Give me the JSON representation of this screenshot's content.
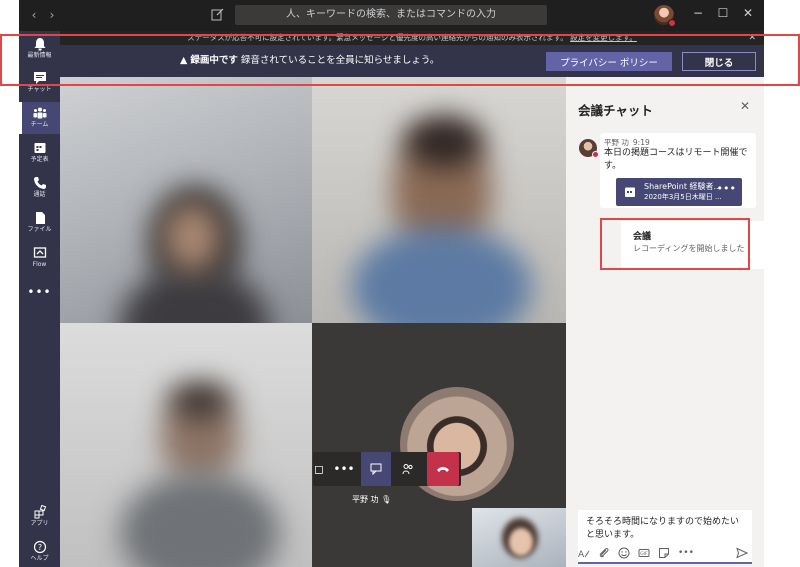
{
  "titlebar": {
    "back_icon": "chevron-left-icon",
    "forward_icon": "chevron-right-icon",
    "search_placeholder": "人、キーワードの検索、またはコマンドの入力",
    "minimize": "−",
    "maximize": "☐",
    "close": "✕"
  },
  "rail": {
    "items": [
      {
        "label": "最新情報",
        "icon": "bell-icon"
      },
      {
        "label": "チャット",
        "icon": "chat-icon"
      },
      {
        "label": "チーム",
        "icon": "teams-icon"
      },
      {
        "label": "予定表",
        "icon": "calendar-icon"
      },
      {
        "label": "通話",
        "icon": "phone-icon"
      },
      {
        "label": "ファイル",
        "icon": "file-icon"
      },
      {
        "label": "Flow",
        "icon": "flow-icon"
      }
    ],
    "more": "•••",
    "bottom": [
      {
        "label": "アプリ",
        "icon": "apps-icon"
      },
      {
        "label": "ヘルプ",
        "icon": "help-icon"
      }
    ]
  },
  "status_bar": {
    "text": "ステータスが応答不可に設定されています。緊急メッセージと優先度の高い連絡先からの通知のみ表示されます。",
    "link": "設定を変更します。",
    "close": "✕"
  },
  "recording_bar": {
    "bold": "録画中です",
    "text": "録音されていることを全員に知らせましょう。",
    "privacy_button": "プライバシー ポリシー",
    "close_button": "閉じる"
  },
  "call": {
    "speaker_name": "平野 功",
    "controls": {
      "more": "•••",
      "chat_icon": "chat-icon",
      "people_icon": "participants-icon",
      "hangup_icon": "hang-up-icon"
    }
  },
  "chat": {
    "title": "会議チャット",
    "close": "✕",
    "message": {
      "author": "平野 功",
      "time": "9:19",
      "text": "本日の掲題コースはリモート開催です。",
      "card_title": "SharePoint 経験者...",
      "card_date": "2020年3月5日木曜日 ...",
      "card_more": "•••"
    },
    "event": {
      "title": "会議",
      "description": "レコーディングを開始しました"
    },
    "compose_text": "そろそろ時間になりますので始めたいと思います。",
    "compose_more": "•••"
  },
  "colors": {
    "rail": "#33344a",
    "accent": "#6264a7",
    "hangup": "#c4314b",
    "highlight": "#e04848"
  }
}
